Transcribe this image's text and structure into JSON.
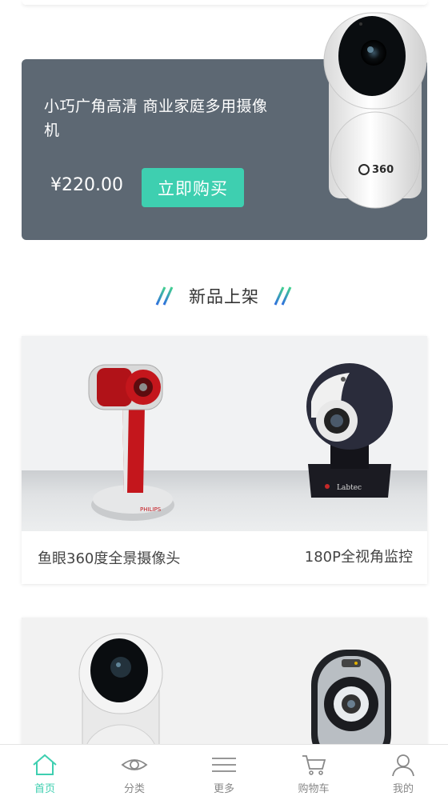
{
  "promo": {
    "title": "小巧广角高清 商业家庭多用摄像机",
    "price": "¥220.00",
    "buy_label": "立即购买",
    "brand_mark": "360"
  },
  "section": {
    "title": "新品上架"
  },
  "products": [
    {
      "left_name": "鱼眼360度全景摄像头",
      "right_name": "180P全视角监控",
      "left_brand": "PHILIPS",
      "right_brand": "Labtec"
    }
  ],
  "tabbar": {
    "items": [
      {
        "label": "首页",
        "icon": "home-icon",
        "active": true
      },
      {
        "label": "分类",
        "icon": "eye-icon",
        "active": false
      },
      {
        "label": "更多",
        "icon": "menu-icon",
        "active": false
      },
      {
        "label": "购物车",
        "icon": "cart-icon",
        "active": false
      },
      {
        "label": "我的",
        "icon": "user-icon",
        "active": false
      }
    ]
  },
  "colors": {
    "accent": "#3ecfb0",
    "banner": "#5d6873"
  }
}
